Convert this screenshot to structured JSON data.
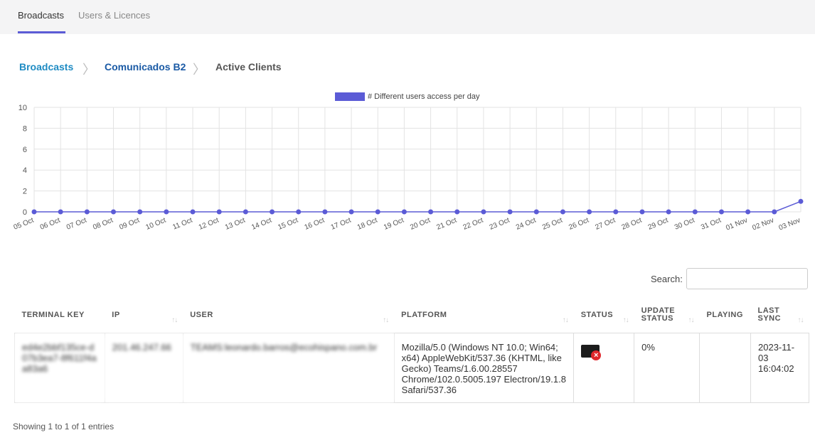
{
  "tabs": [
    {
      "label": "Broadcasts",
      "active": true
    },
    {
      "label": "Users & Licences",
      "active": false
    }
  ],
  "breadcrumb": {
    "items": [
      "Broadcasts",
      "Comunicados B2",
      "Active Clients"
    ],
    "separator": ">"
  },
  "chart_data": {
    "type": "line",
    "legend": "# Different users access per day",
    "color": "#5b5bd6",
    "categories": [
      "05 Oct",
      "06 Oct",
      "07 Oct",
      "08 Oct",
      "09 Oct",
      "10 Oct",
      "11 Oct",
      "12 Oct",
      "13 Oct",
      "14 Oct",
      "15 Oct",
      "16 Oct",
      "17 Oct",
      "18 Oct",
      "19 Oct",
      "20 Oct",
      "21 Oct",
      "22 Oct",
      "23 Oct",
      "24 Oct",
      "25 Oct",
      "26 Oct",
      "27 Oct",
      "28 Oct",
      "29 Oct",
      "30 Oct",
      "31 Oct",
      "01 Nov",
      "02 Nov",
      "03 Nov"
    ],
    "values": [
      0,
      0,
      0,
      0,
      0,
      0,
      0,
      0,
      0,
      0,
      0,
      0,
      0,
      0,
      0,
      0,
      0,
      0,
      0,
      0,
      0,
      0,
      0,
      0,
      0,
      0,
      0,
      0,
      0,
      1
    ],
    "ylim": [
      0,
      10
    ],
    "yticks": [
      "0",
      "2",
      "4",
      "6",
      "8",
      "10"
    ],
    "grid": true,
    "legend_position": "top-center"
  },
  "search": {
    "label": "Search:",
    "value": ""
  },
  "table": {
    "columns": [
      "TERMINAL KEY",
      "IP",
      "USER",
      "PLATFORM",
      "STATUS",
      "UPDATE STATUS",
      "PLAYING",
      "LAST SYNC"
    ],
    "sort_icon": "↑↓",
    "rows": [
      {
        "terminal_key": "ed4e2bbf135ce-d07b3ea7-8f611f4aa83a6",
        "ip": "201.46.247.66",
        "user": "TEAMS:leonardo.barros@ecohispano.com.br",
        "platform": "Mozilla/5.0 (Windows NT 10.0; Win64; x64) AppleWebKit/537.36 (KHTML, like Gecko) Teams/1.6.00.28557 Chrome/102.0.5005.197 Electron/19.1.8 Safari/537.36",
        "status_icon": "monitor-offline-icon",
        "status_badge": "×",
        "update_status": "0%",
        "playing": "",
        "last_sync": "2023-11-03 16:04:02"
      }
    ]
  },
  "footer": {
    "info": "Showing 1 to 1 of 1 entries"
  }
}
